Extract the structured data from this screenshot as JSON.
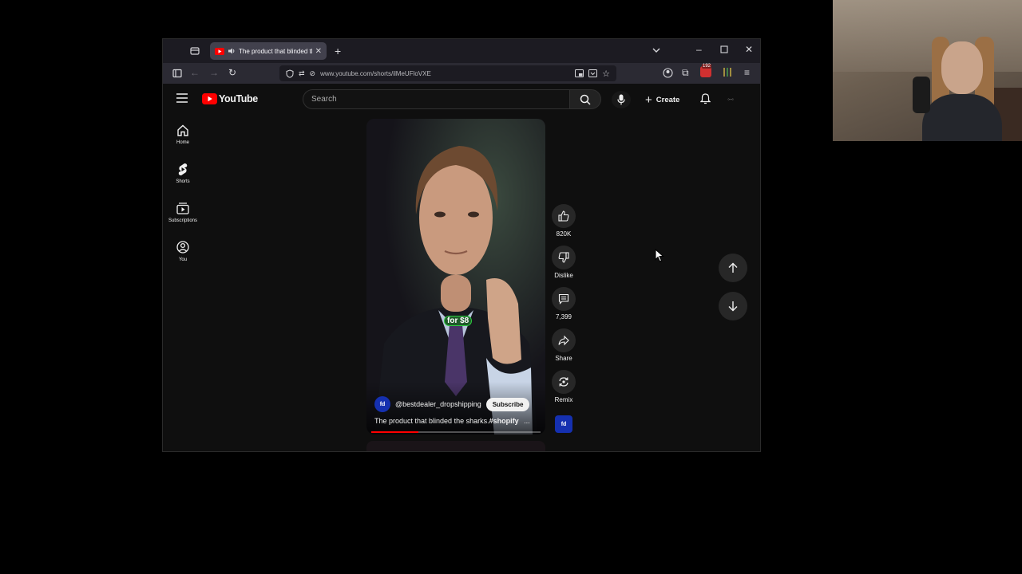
{
  "browser": {
    "tab_title": "The product that blinded th",
    "url": "www.youtube.com/shorts/ilMeUFloVXE",
    "extension_badge": "192"
  },
  "youtube": {
    "logo_text": "YouTube",
    "search_placeholder": "Search",
    "create_label": "Create",
    "sidebar": [
      {
        "label": "Home",
        "icon": "home-icon"
      },
      {
        "label": "Shorts",
        "icon": "shorts-icon"
      },
      {
        "label": "Subscriptions",
        "icon": "subscriptions-icon"
      },
      {
        "label": "You",
        "icon": "you-icon"
      }
    ],
    "short": {
      "caption": "for $8",
      "channel": "@bestdealer_dropshipping",
      "subscribe_label": "Subscribe",
      "title": "The product that blinded the sharks.",
      "hashtag": "#shopify",
      "more": "...",
      "progress": 0.28
    },
    "actions": {
      "like_count": "820K",
      "dislike_label": "Dislike",
      "comment_count": "7,399",
      "share_label": "Share",
      "remix_label": "Remix"
    }
  },
  "colors": {
    "accent_red": "#ff0000",
    "caption_green": "#2ecc40"
  }
}
